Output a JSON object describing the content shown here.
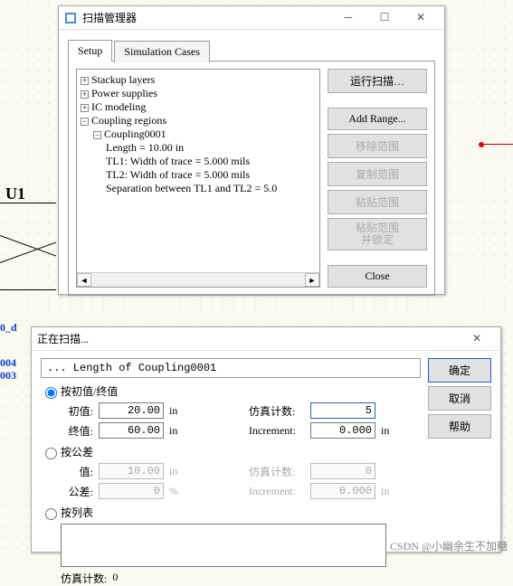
{
  "bg": {
    "u1": "U1",
    "od": "0_d",
    "r1": "004",
    "r2": "003"
  },
  "mgr": {
    "title": "扫描管理器",
    "tabs": {
      "setup": "Setup",
      "sim": "Simulation Cases"
    },
    "tree": {
      "stackup": "Stackup layers",
      "power": "Power supplies",
      "ic": "IC modeling",
      "coupling": "Coupling regions",
      "coup0001": "Coupling0001",
      "length": "Length = 10.00 in",
      "tl1": "TL1: Width of trace = 5.000 mils",
      "tl2": "TL2: Width of trace = 5.000 mils",
      "sep": "Separation between TL1 and TL2 = 5.0"
    },
    "buttons": {
      "run": "运行扫描…",
      "addrange": "Add Range...",
      "delrange": "移除范围",
      "copyrange": "复制范围",
      "pasterange": "粘贴范围",
      "pastelock": "粘贴范围\n并锁定",
      "close": "Close"
    }
  },
  "scan": {
    "title": "正在扫描...",
    "status": "... Length of Coupling0001",
    "radio_initend": "按初值/终值",
    "radio_tol": "按公差",
    "radio_list": "按列表",
    "label_init": "初值:",
    "label_end": "终值:",
    "label_val": "值:",
    "label_tol": "公差:",
    "label_simcount": "仿真计数:",
    "label_simcount2": "仿真计数:",
    "label_inc": "Increment:",
    "unit_in": "in",
    "unit_pct": "%",
    "val_init": "20.00",
    "val_end": "60.00",
    "val_count1": "5",
    "val_inc1": "0.000",
    "val_val": "10.00",
    "val_tol": "0",
    "val_count2": "0",
    "val_inc2": "0.000",
    "list_count_label": "仿真计数:",
    "list_count_val": "0",
    "buttons": {
      "ok": "确定",
      "cancel": "取消",
      "help": "帮助"
    }
  },
  "watermark": "CSDN @小幽余生不加糖"
}
